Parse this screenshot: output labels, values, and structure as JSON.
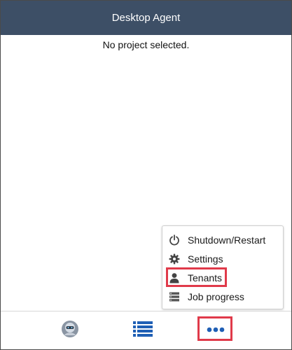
{
  "window": {
    "title": "Desktop Agent"
  },
  "main": {
    "status_text": "No project selected."
  },
  "menu": {
    "items": [
      {
        "label": "Shutdown/Restart",
        "icon": "power-icon"
      },
      {
        "label": "Settings",
        "icon": "gear-icon"
      },
      {
        "label": "Tenants",
        "icon": "user-icon"
      },
      {
        "label": "Job progress",
        "icon": "server-stack-icon"
      }
    ]
  },
  "bottom_nav": {
    "tabs": [
      {
        "name": "agent",
        "icon": "robot-avatar-icon"
      },
      {
        "name": "list",
        "icon": "list-icon"
      },
      {
        "name": "more",
        "icon": "more-dots-icon"
      }
    ]
  },
  "colors": {
    "titlebar": "#3d4f66",
    "accent": "#1f5fb5",
    "highlight": "#e03a4a"
  }
}
